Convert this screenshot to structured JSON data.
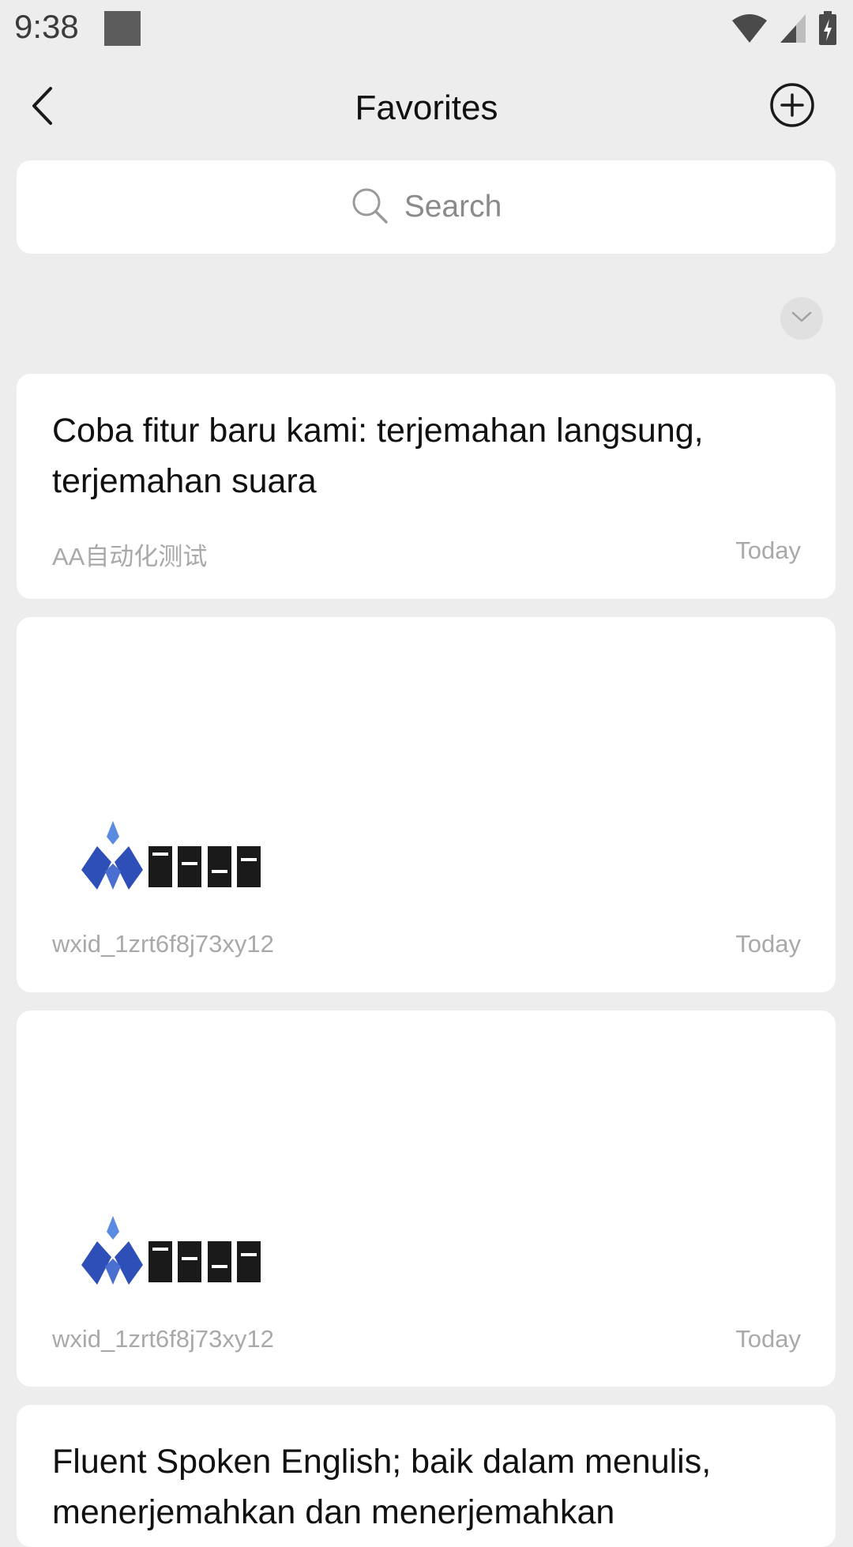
{
  "status_bar": {
    "time": "9:38"
  },
  "header": {
    "title": "Favorites"
  },
  "search": {
    "placeholder": "Search"
  },
  "items": [
    {
      "type": "text",
      "text": "Coba fitur baru kami: terjemahan langsung, terjemahan suara",
      "source": "AA自动化测试",
      "date": "Today"
    },
    {
      "type": "image",
      "source": "wxid_1zrt6f8j73xy12",
      "date": "Today"
    },
    {
      "type": "image",
      "source": "wxid_1zrt6f8j73xy12",
      "date": "Today"
    },
    {
      "type": "text",
      "text": "Fluent Spoken English; baik dalam menulis, menerjemahkan dan menerjemahkan"
    }
  ],
  "colors": {
    "background": "#ededed",
    "card": "#ffffff",
    "meta_text": "#a9a9a9",
    "logo_blue": "#2f4fb8"
  }
}
